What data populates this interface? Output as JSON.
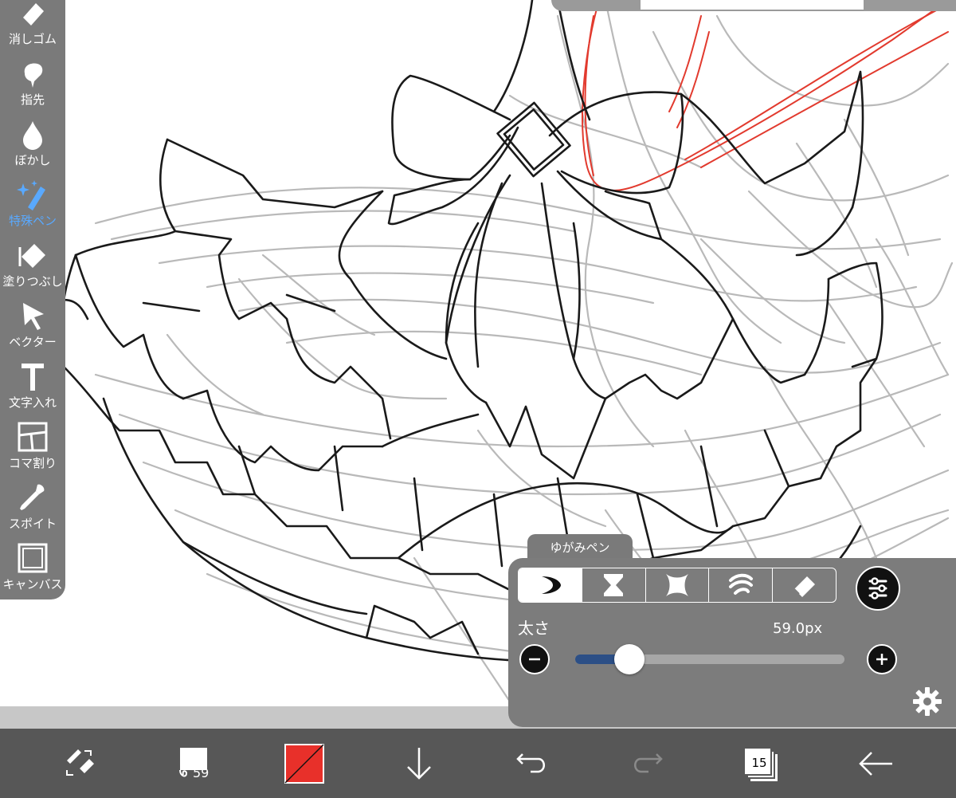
{
  "toolbar": {
    "tools": [
      {
        "id": "eraser",
        "label": "消しゴム",
        "icon": "eraser-icon"
      },
      {
        "id": "finger",
        "label": "指先",
        "icon": "finger-icon"
      },
      {
        "id": "blur",
        "label": "ぼかし",
        "icon": "blur-drop-icon"
      },
      {
        "id": "special-pen",
        "label": "特殊ペン",
        "icon": "magic-pen-icon",
        "active": true
      },
      {
        "id": "fill",
        "label": "塗りつぶし",
        "icon": "bucket-fill-icon"
      },
      {
        "id": "vector",
        "label": "ベクター",
        "icon": "cursor-arrow-icon"
      },
      {
        "id": "text",
        "label": "文字入れ",
        "icon": "text-t-icon"
      },
      {
        "id": "frame",
        "label": "コマ割り",
        "icon": "panel-divide-icon"
      },
      {
        "id": "eyedropper",
        "label": "スポイト",
        "icon": "eyedropper-icon"
      },
      {
        "id": "canvas",
        "label": "キャンバス",
        "icon": "canvas-square-icon"
      }
    ],
    "active_color": "#59a9ff"
  },
  "brush_panel": {
    "tab_label": "ゆがみペン",
    "modes": [
      {
        "icon": "crescent-icon",
        "selected": true
      },
      {
        "icon": "hourglass-icon",
        "selected": false
      },
      {
        "icon": "pinch-shape-icon",
        "selected": false
      },
      {
        "icon": "wave-swirl-icon",
        "selected": false
      },
      {
        "icon": "eraser-icon",
        "selected": false
      }
    ],
    "size_label": "太さ",
    "size_value": "59.0px",
    "slider_fraction": 0.2
  },
  "bottom_bar": {
    "brush_size": "59",
    "current_color": "#e8302a",
    "layers_count": "15"
  }
}
